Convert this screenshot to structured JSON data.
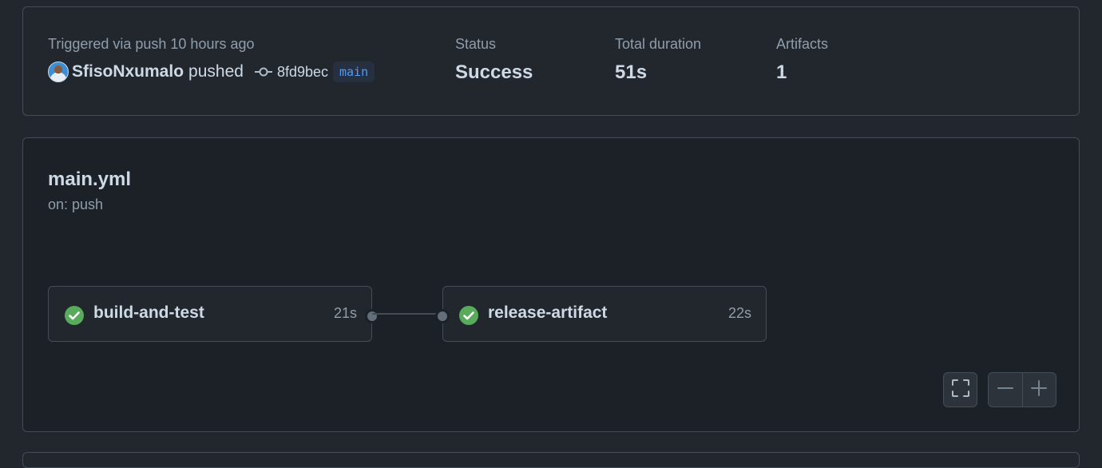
{
  "summary": {
    "trigger_text": "Triggered via push 10 hours ago",
    "actor": "SfisoNxumalo",
    "action": "pushed",
    "commit_sha": "8fd9bec",
    "branch": "main",
    "status_label": "Status",
    "status_value": "Success",
    "duration_label": "Total duration",
    "duration_value": "51s",
    "artifacts_label": "Artifacts",
    "artifacts_value": "1"
  },
  "workflow": {
    "file": "main.yml",
    "trigger": "on: push",
    "jobs": [
      {
        "name": "build-and-test",
        "duration": "21s",
        "status": "success"
      },
      {
        "name": "release-artifact",
        "duration": "22s",
        "status": "success"
      }
    ]
  },
  "icons": {
    "avatar": "user-avatar",
    "commit": "git-commit-icon",
    "check": "check-circle-fill-icon",
    "fullscreen": "screen-full-icon",
    "zoom_out": "minus-icon",
    "zoom_in": "plus-icon"
  },
  "colors": {
    "success": "#57ab5a",
    "link": "#539bf5",
    "border": "#444c56"
  }
}
